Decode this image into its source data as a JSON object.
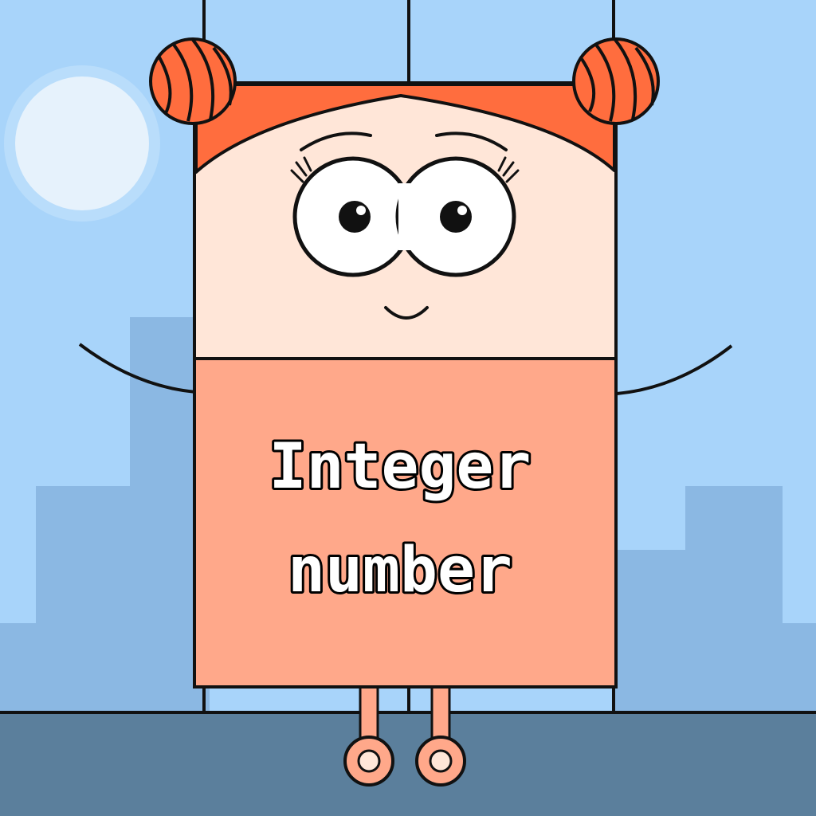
{
  "character": {
    "label_line1": "Integer",
    "label_line2": "number"
  },
  "colors": {
    "sky": "#a8d4fa",
    "buildings": "#8bb8e3",
    "ground": "#5b7f9c",
    "sun": "#e6f2fc",
    "hair": "#ff6d3e",
    "face": "#ffe6d8",
    "body": "#ffa88a",
    "outline": "#111111"
  },
  "icons": {
    "left_bun": "hair-bun-icon",
    "right_bun": "hair-bun-icon"
  }
}
